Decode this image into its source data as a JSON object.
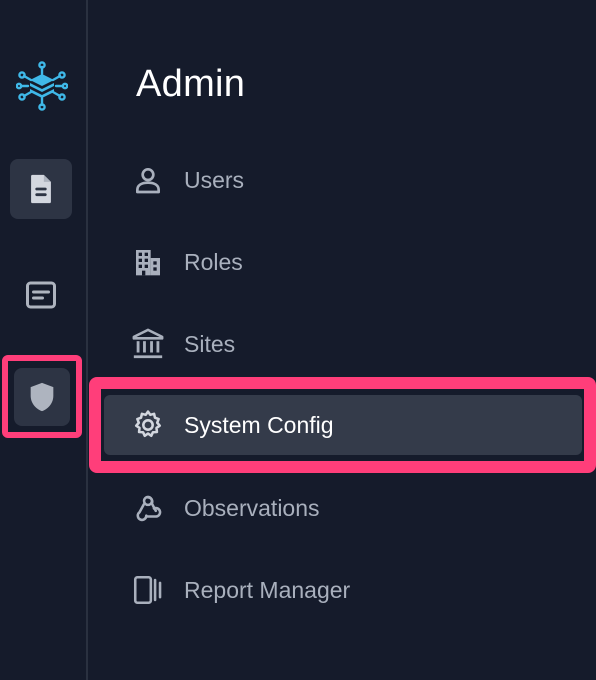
{
  "app": {
    "logo_icon": "network-cube-icon",
    "accent_color": "#3fb8e8",
    "highlight_color": "#ff3e7a"
  },
  "rail": {
    "items": [
      {
        "icon": "document-icon",
        "active": true
      },
      {
        "icon": "note-icon",
        "active": false
      },
      {
        "icon": "shield-icon",
        "active": false
      }
    ]
  },
  "admin": {
    "title": "Admin",
    "items": [
      {
        "label": "Users",
        "icon": "user-icon"
      },
      {
        "label": "Roles",
        "icon": "building-icon"
      },
      {
        "label": "Sites",
        "icon": "bank-icon"
      },
      {
        "label": "System Config",
        "icon": "gear-icon",
        "active": true
      },
      {
        "label": "Observations",
        "icon": "webhook-icon"
      },
      {
        "label": "Report Manager",
        "icon": "panels-icon"
      }
    ]
  }
}
